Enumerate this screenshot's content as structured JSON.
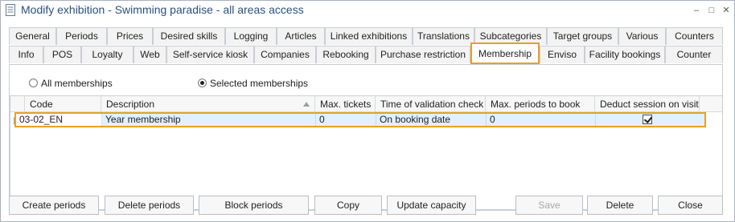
{
  "window": {
    "title": "Modify exhibition - Swimming paradise - all areas access",
    "minimize_glyph": "–",
    "maximize_glyph": "□",
    "close_glyph": "✕"
  },
  "tabs": {
    "row1": [
      "General",
      "Periods",
      "Prices",
      "Desired skills",
      "Logging",
      "Articles",
      "Linked exhibitions",
      "Translations",
      "Subcategories",
      "Target groups",
      "Various",
      "Counters"
    ],
    "row2": [
      "Info",
      "POS",
      "Loyalty",
      "Web",
      "Self-service kiosk",
      "Companies",
      "Rebooking",
      "Purchase restriction",
      "Membership",
      "Enviso",
      "Facility bookings",
      "Counter"
    ],
    "active": "Membership"
  },
  "options": {
    "all_memberships": "All memberships",
    "selected_memberships": "Selected memberships",
    "selected": "selected_memberships"
  },
  "grid": {
    "columns": [
      "Code",
      "Description",
      "Max. tickets",
      "Time of validation check",
      "Max. periods to book",
      "Deduct session on visit"
    ],
    "rows": [
      {
        "code": "03-02_EN",
        "description": "Year membership",
        "max_tickets": "0",
        "time_of_validation_check": "On booking date",
        "max_periods_to_book": "0",
        "deduct_session_on_visit": true
      }
    ]
  },
  "buttons": {
    "create_periods": "Create periods",
    "delete_periods": "Delete periods",
    "block_periods": "Block periods",
    "copy": "Copy",
    "update_capacity": "Update capacity",
    "save": "Save",
    "delete": "Delete",
    "close": "Close"
  },
  "colors": {
    "title": "#2b4f7e",
    "highlight": "#e8a124",
    "selected_row": "#e3f0fb"
  }
}
